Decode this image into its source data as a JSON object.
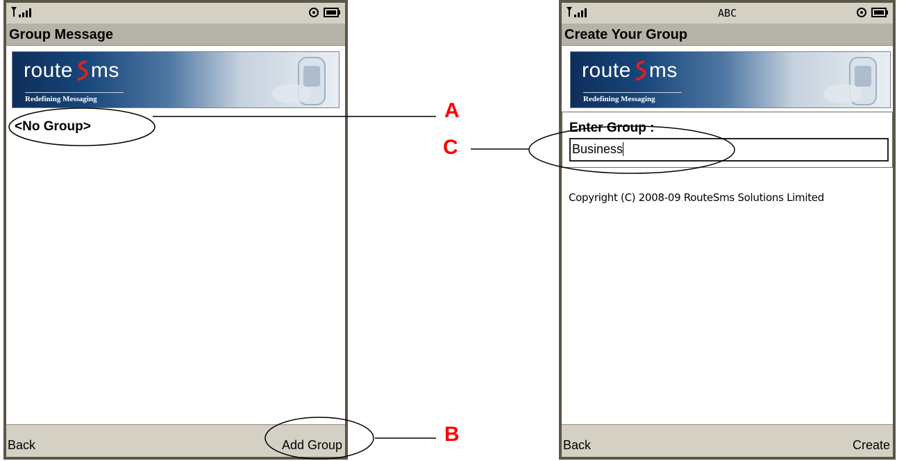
{
  "left_screen": {
    "status_indicator": "signal-icon",
    "title": "Group Message",
    "banner": {
      "brand_left": "route",
      "brand_right": "ms",
      "tagline": "Redefining Messaging"
    },
    "list_item": "<No Group>",
    "softkeys": {
      "left": "Back",
      "right": "Add Group"
    }
  },
  "right_screen": {
    "status_text": "ABC",
    "title": "Create Your Group",
    "banner": {
      "brand_left": "route",
      "brand_right": "ms",
      "tagline": "Redefining Messaging"
    },
    "form": {
      "label": "Enter Group :",
      "input_value": "Business"
    },
    "copyright": "Copyright (C) 2008-09 RouteSms Solutions Limited",
    "softkeys": {
      "left": "Back",
      "right": "Create"
    }
  },
  "callouts": [
    {
      "letter": "A"
    },
    {
      "letter": "B"
    },
    {
      "letter": "C"
    }
  ],
  "colors": {
    "callout": "#ff0000",
    "banner_dark": "#0e2e5c",
    "chrome": "#d4d0c4",
    "title_bar": "#b5b2a8"
  }
}
